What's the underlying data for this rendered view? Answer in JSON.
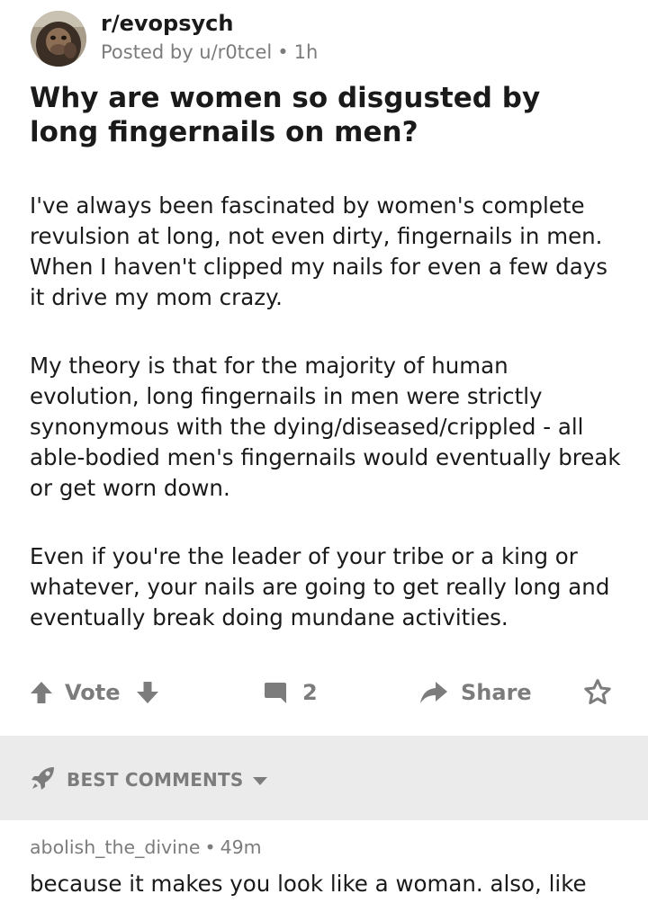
{
  "post": {
    "subreddit": "r/evopsych",
    "posted_by": "Posted by u/r0tcel",
    "separator": "•",
    "age": "1h",
    "title": "Why are women so disgusted by long fingernails on men?",
    "paragraphs": [
      "I've always been fascinated by women's complete revulsion at long, not even dirty, fingernails in men. When I haven't clipped my nails for even a few days it drive my mom crazy.",
      "My theory is that for the majority of human evolution, long fingernails in men were strictly synonymous with the dying/diseased/crippled - all able-bodied men's fingernails would eventually break or get worn down.",
      "Even if you're the leader of your tribe or a king or whatever, your nails are going to get really long and eventually break doing mundane activities."
    ]
  },
  "actions": {
    "vote_label": "Vote",
    "comment_count": "2",
    "share_label": "Share",
    "icons": [
      "upvote-icon",
      "downvote-icon",
      "comment-icon",
      "share-icon",
      "award-icon"
    ]
  },
  "comments_section": {
    "sort_label": "BEST COMMENTS",
    "sort_icon": "rocket-icon"
  },
  "comment": {
    "author": "abolish_the_divine",
    "separator": "•",
    "age": "49m",
    "text": "because it makes you look like a woman. also, like"
  },
  "colors": {
    "text": "#1a1a1b",
    "muted": "#7c7c7c",
    "band_background": "#ebebeb"
  }
}
